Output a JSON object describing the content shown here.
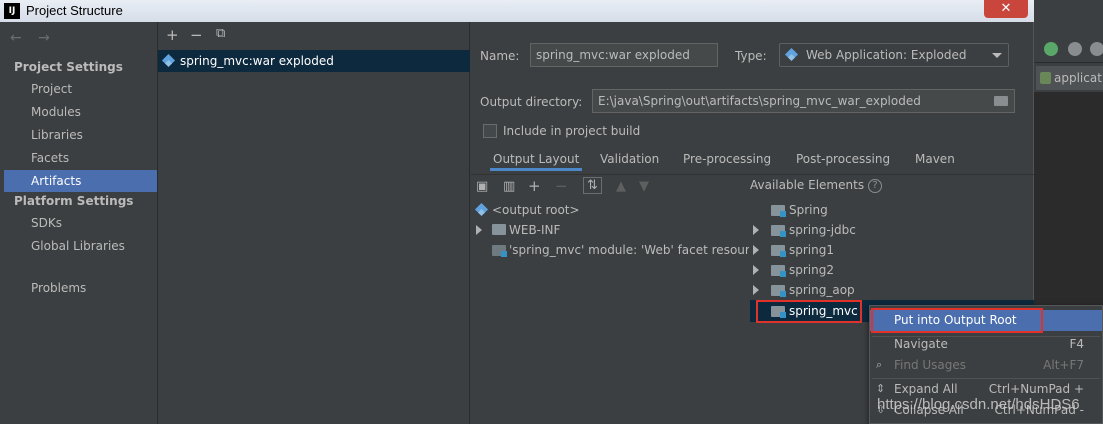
{
  "window": {
    "title": "Project Structure",
    "close_glyph": "✕",
    "app_icon_text": "IJ"
  },
  "nav": {
    "back_forward": "← →",
    "sections": [
      {
        "title": "Project Settings",
        "items": [
          "Project",
          "Modules",
          "Libraries",
          "Facets",
          "Artifacts"
        ]
      },
      {
        "title": "Platform Settings",
        "items": [
          "SDKs",
          "Global Libraries"
        ]
      }
    ],
    "problems": "Problems",
    "selected": "Artifacts"
  },
  "artifacts": {
    "toolbar": {
      "add": "+",
      "remove": "−",
      "copy": "⧉"
    },
    "items": [
      "spring_mvc:war exploded"
    ]
  },
  "details": {
    "name_label": "Name:",
    "name_value": "spring_mvc:war exploded",
    "type_label": "Type:",
    "type_value": "Web Application: Exploded",
    "output_dir_label": "Output directory:",
    "output_dir_value": "E:\\java\\Spring\\out\\artifacts\\spring_mvc_war_exploded",
    "include_label": "Include in project build",
    "include_checked": false,
    "tabs": [
      "Output Layout",
      "Validation",
      "Pre-processing",
      "Post-processing",
      "Maven"
    ],
    "active_tab": "Output Layout"
  },
  "output_layout": {
    "tree": [
      {
        "label": "<output root>",
        "icon": "artifact-root-icon",
        "expandable": false
      },
      {
        "label": "WEB-INF",
        "icon": "folder-icon",
        "expandable": true
      },
      {
        "label": "'spring_mvc' module: 'Web' facet resourc",
        "icon": "web-facet-icon",
        "expandable": false
      }
    ]
  },
  "available": {
    "title": "Available Elements",
    "help": "?",
    "items": [
      {
        "label": "Spring",
        "expandable": false
      },
      {
        "label": "spring-jdbc",
        "expandable": true
      },
      {
        "label": "spring1",
        "expandable": true
      },
      {
        "label": "spring2",
        "expandable": true
      },
      {
        "label": "spring_aop",
        "expandable": true
      },
      {
        "label": "spring_mvc",
        "expandable": false,
        "selected": true
      }
    ]
  },
  "context_menu": {
    "items": [
      {
        "label": "Put into Output Root",
        "shortcut": "",
        "highlighted": true
      },
      {
        "label": "Navigate",
        "shortcut": "F4"
      },
      {
        "label": "Find Usages",
        "shortcut": "Alt+F7",
        "disabled": true
      },
      {
        "label": "Expand All",
        "shortcut": "Ctrl+NumPad +"
      },
      {
        "label": "Collapse All",
        "shortcut": "Ctrl+NumPad -"
      }
    ]
  },
  "background_ide": {
    "tab_label": "applicati"
  },
  "watermark": "https://blog.csdn.net/hdsHDS6",
  "colors": {
    "selection": "#4b6eaf",
    "tree_selection": "#0d293e",
    "highlight_box": "#e0312b",
    "title_bar": "#d6dde8"
  }
}
